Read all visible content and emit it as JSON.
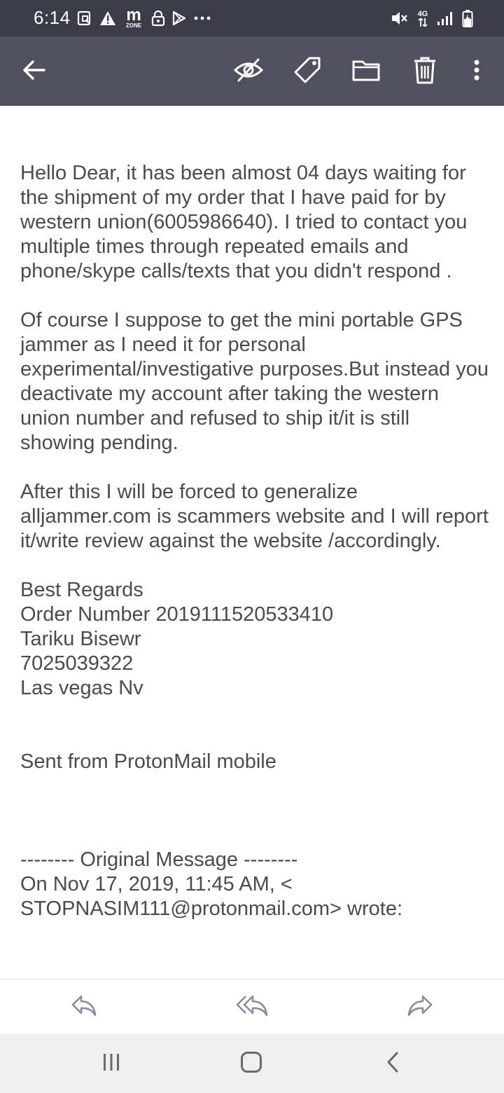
{
  "status_bar": {
    "time": "6:14",
    "left_icons": [
      "screenshot-icon",
      "warning-icon",
      "mzone-icon",
      "lock-icon",
      "play-store-icon",
      "more-dots-icon"
    ],
    "mzone_text": "m",
    "mzone_subtext": "ZONE",
    "right_icons": [
      "mute-icon",
      "4g-lte-icon",
      "signal-icon",
      "battery-icon"
    ],
    "network_label": "4G"
  },
  "toolbar": {
    "icons": [
      "back-arrow-icon",
      "mark-unread-icon",
      "label-tag-icon",
      "move-folder-icon",
      "trash-icon",
      "more-vert-icon"
    ]
  },
  "email": {
    "paragraphs": [
      "Hello Dear, it has been almost 04 days waiting for the shipment of my order that I have paid for by western union(6005986640). I tried to contact you multiple times through repeated emails and phone/skype calls/texts that you didn't respond .",
      "Of course I suppose to get the mini portable GPS jammer as I need it for personal experimental/investigative purposes.But instead you deactivate my account after taking the western union number and refused to ship it/it is still showing pending.",
      "After this I will be forced to generalize alljammer.com is scammers website and I will report it/write review against the website /accordingly."
    ],
    "signature_lines": [
      "Best Regards",
      "Order Number 2019111520533410",
      "Tariku Bisewr",
      "7025039322",
      "Las vegas Nv"
    ],
    "sent_from": "Sent from ProtonMail mobile",
    "original_header": "-------- Original Message --------",
    "original_on": "On Nov 17, 2019, 11:45 AM, <",
    "original_from": "STOPNASIM111@protonmail.com> wrote:"
  },
  "bottom_actions": [
    "reply-icon",
    "reply-all-icon",
    "forward-icon"
  ],
  "nav_bar": [
    "recent-apps-icon",
    "home-icon",
    "back-icon"
  ],
  "colors": {
    "status_bar": "#3b3c47",
    "toolbar": "#505061",
    "body_text": "#4b4b4f",
    "action_icon": "#8a8aa3",
    "nav_bar": "#efefef"
  }
}
